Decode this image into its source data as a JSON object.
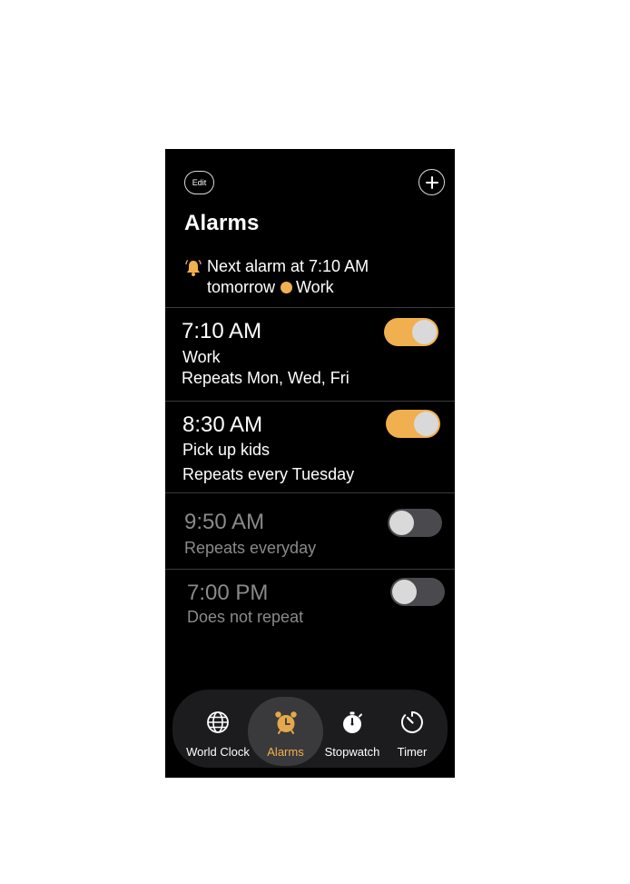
{
  "header": {
    "edit_label": "Edit",
    "title": "Alarms"
  },
  "next_alarm": {
    "line1": "Next alarm at 7:10 AM",
    "line2_prefix": "tomorrow",
    "line2_label": "Work"
  },
  "alarms": [
    {
      "time": "7:10 AM",
      "label": "Work",
      "repeat": "Repeats Mon, Wed, Fri",
      "enabled": true
    },
    {
      "time": "8:30 AM",
      "label": "Pick up kids",
      "repeat": "Repeats every Tuesday",
      "enabled": true
    },
    {
      "time": "9:50 AM",
      "label": "",
      "repeat": "Repeats everyday",
      "enabled": false
    },
    {
      "time": "7:00 PM",
      "label": "",
      "repeat": "Does not repeat",
      "enabled": false
    }
  ],
  "tabs": [
    {
      "label": "World Clock",
      "icon": "globe-icon",
      "active": false
    },
    {
      "label": "Alarms",
      "icon": "alarm-clock-icon",
      "active": true
    },
    {
      "label": "Stopwatch",
      "icon": "stopwatch-icon",
      "active": false
    },
    {
      "label": "Timer",
      "icon": "timer-icon",
      "active": false
    }
  ],
  "colors": {
    "accent": "#f0b04f",
    "background": "#000000",
    "toggle_off": "#4a4a4e",
    "muted_text": "#8a8a8a"
  }
}
